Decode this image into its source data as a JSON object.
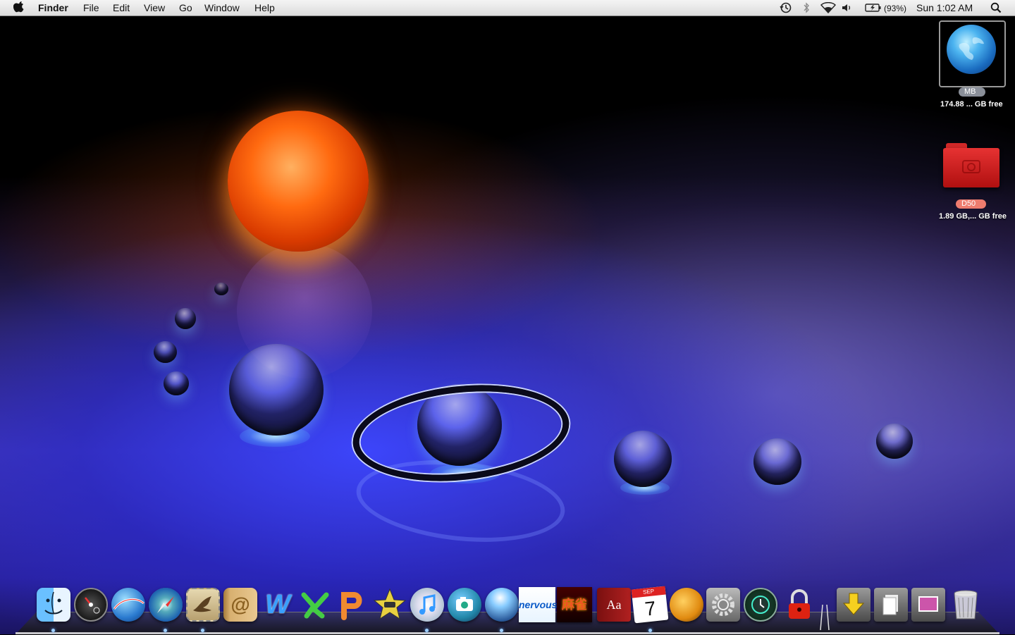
{
  "menubar": {
    "app_name": "Finder",
    "menus": [
      "File",
      "Edit",
      "View",
      "Go",
      "Window",
      "Help"
    ],
    "battery_percent": "(93%)",
    "clock": "Sun 1:02 AM",
    "status_icons": [
      "time-machine-icon",
      "bluetooth-icon",
      "wifi-icon",
      "volume-icon",
      "battery-icon",
      "spotlight-icon"
    ]
  },
  "desktop": {
    "volumes": [
      {
        "name": "MB",
        "info": "174.88 ... GB free",
        "icon": "globe-drive-icon",
        "color": "#8a8f99"
      },
      {
        "name": "D50",
        "info": "1.89 GB,... GB free",
        "icon": "red-folder-icon",
        "color": "#ee7c6e"
      }
    ]
  },
  "dock": {
    "items": [
      {
        "name": "Finder",
        "icon": "finder-icon"
      },
      {
        "name": "Dashboard",
        "icon": "dashboard-icon"
      },
      {
        "name": "Google Earth",
        "icon": "google-earth-icon"
      },
      {
        "name": "Safari",
        "icon": "safari-icon"
      },
      {
        "name": "Mail",
        "icon": "mail-icon"
      },
      {
        "name": "Address Book",
        "icon": "address-book-icon"
      },
      {
        "name": "Word",
        "icon": "word-icon"
      },
      {
        "name": "Excel",
        "icon": "excel-icon"
      },
      {
        "name": "PowerPoint",
        "icon": "powerpoint-icon"
      },
      {
        "name": "iMovie",
        "icon": "imovie-icon"
      },
      {
        "name": "iTunes",
        "icon": "itunes-icon"
      },
      {
        "name": "iPhoto",
        "icon": "camera-icon"
      },
      {
        "name": "Orb",
        "icon": "orb-icon"
      },
      {
        "name": "Nervous Breakdown",
        "icon": "nervous-icon"
      },
      {
        "name": "Mahjong",
        "icon": "mahjong-icon"
      },
      {
        "name": "Dictionary",
        "icon": "dictionary-icon"
      },
      {
        "name": "iCal",
        "icon": "calendar-icon"
      },
      {
        "name": "Game",
        "icon": "game-icon"
      },
      {
        "name": "System Preferences",
        "icon": "system-preferences-icon"
      },
      {
        "name": "Time Machine",
        "icon": "time-machine-app-icon"
      },
      {
        "name": "Keychain",
        "icon": "padlock-icon"
      },
      {
        "name": "Downloads",
        "icon": "downloads-stack-icon"
      },
      {
        "name": "Documents",
        "icon": "documents-stack-icon"
      },
      {
        "name": "Pictures",
        "icon": "pictures-stack-icon"
      },
      {
        "name": "Trash",
        "icon": "trash-icon"
      }
    ],
    "labels": {
      "word_glyph": "W",
      "dictionary_glyph": "Aa",
      "calendar_month": "SEP",
      "calendar_day": "7",
      "nervous_text": "nervous",
      "mahjong_glyph": "麻雀"
    }
  }
}
